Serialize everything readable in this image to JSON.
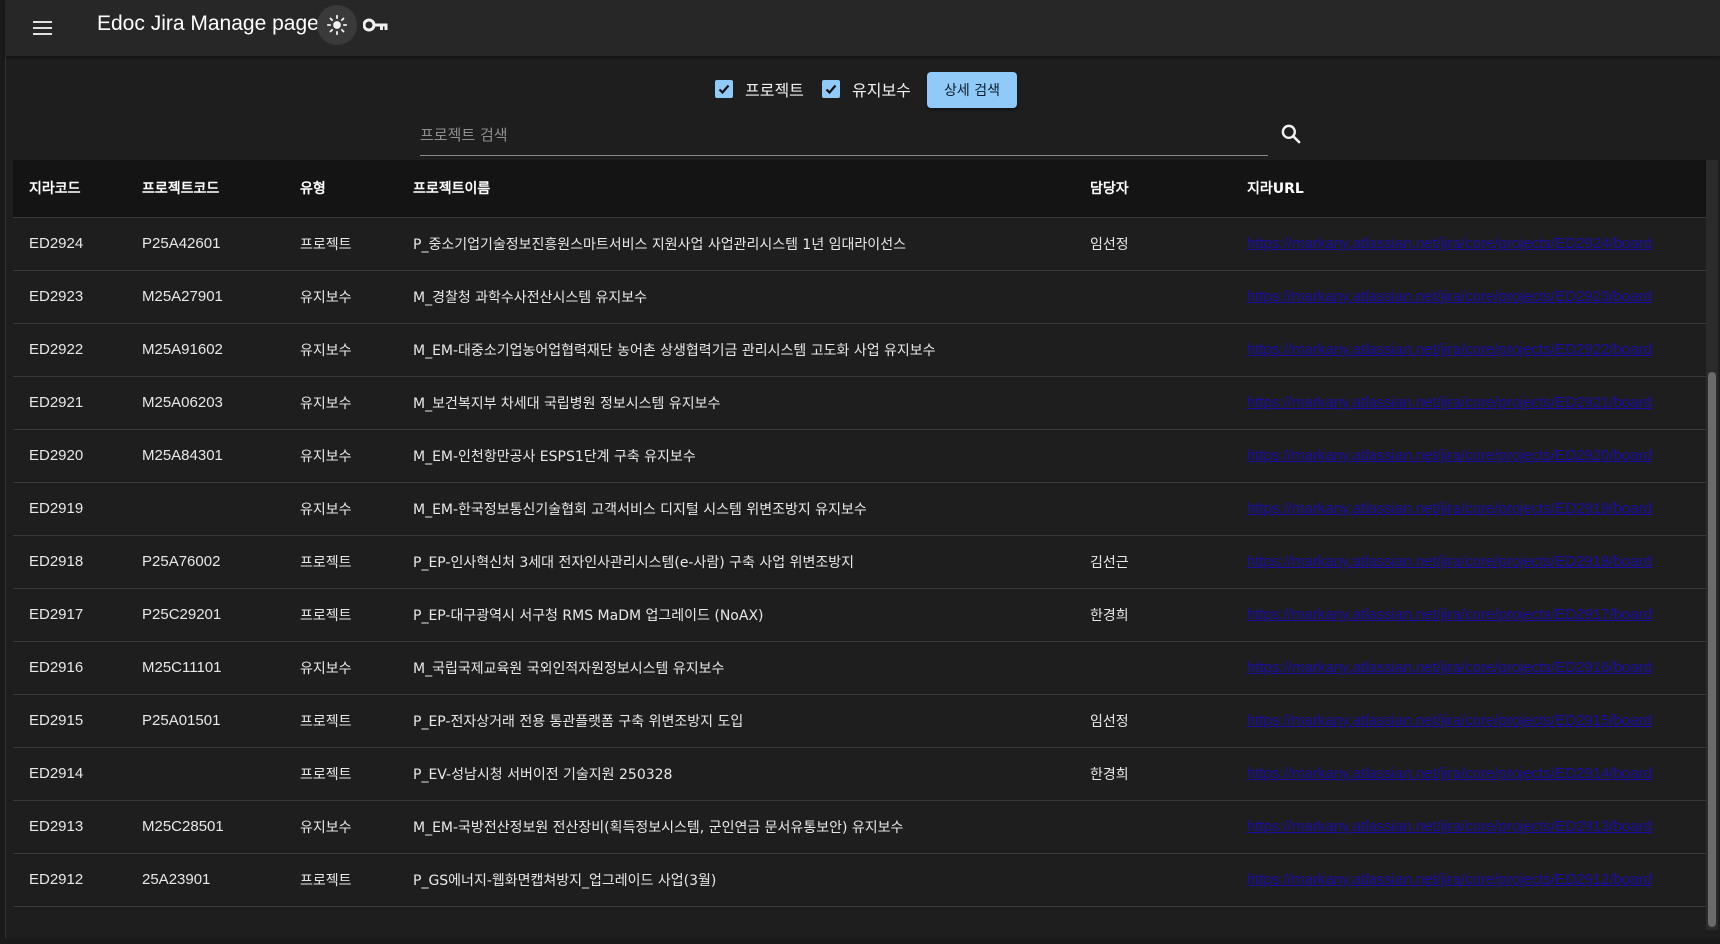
{
  "appbar": {
    "title": "Edoc Jira Manage page",
    "menu_icon": "menu-icon",
    "theme_icon": "sun-icon",
    "key_icon": "key-icon"
  },
  "filters": {
    "project_label": "프로젝트",
    "project_checked": true,
    "maintenance_label": "유지보수",
    "maintenance_checked": true,
    "detail_search_label": "상세 검색"
  },
  "search": {
    "placeholder": "프로젝트 검색",
    "value": ""
  },
  "table": {
    "headers": [
      "지라코드",
      "프로젝트코드",
      "유형",
      "프로젝트이름",
      "담당자",
      "지라URL"
    ],
    "rows": [
      {
        "jira": "ED2924",
        "code": "P25A42601",
        "type": "프로젝트",
        "name": "P_중소기업기술정보진흥원스마트서비스 지원사업 사업관리시스템 1년 임대라이선스",
        "owner": "임선정",
        "url": "https://markany.atlassian.net/jira/core/projects/ED2924/board"
      },
      {
        "jira": "ED2923",
        "code": "M25A27901",
        "type": "유지보수",
        "name": "M_경찰청 과학수사전산시스템 유지보수",
        "owner": "",
        "url": "https://markany.atlassian.net/jira/core/projects/ED2923/board"
      },
      {
        "jira": "ED2922",
        "code": "M25A91602",
        "type": "유지보수",
        "name": "M_EM-대중소기업농어업협력재단 농어촌 상생협력기금 관리시스템 고도화 사업 유지보수",
        "owner": "",
        "url": "https://markany.atlassian.net/jira/core/projects/ED2922/board"
      },
      {
        "jira": "ED2921",
        "code": "M25A06203",
        "type": "유지보수",
        "name": "M_보건복지부 차세대 국립병원 정보시스템 유지보수",
        "owner": "",
        "url": "https://markany.atlassian.net/jira/core/projects/ED2921/board"
      },
      {
        "jira": "ED2920",
        "code": "M25A84301",
        "type": "유지보수",
        "name": "M_EM-인천항만공사 ESPS1단계 구축 유지보수",
        "owner": "",
        "url": "https://markany.atlassian.net/jira/core/projects/ED2920/board"
      },
      {
        "jira": "ED2919",
        "code": "",
        "type": "유지보수",
        "name": "M_EM-한국정보통신기술협회 고객서비스 디지털 시스템 위변조방지 유지보수",
        "owner": "",
        "url": "https://markany.atlassian.net/jira/core/projects/ED2919/board"
      },
      {
        "jira": "ED2918",
        "code": "P25A76002",
        "type": "프로젝트",
        "name": "P_EP-인사혁신처 3세대 전자인사관리시스템(e-사람) 구축 사업 위변조방지",
        "owner": "김선근",
        "url": "https://markany.atlassian.net/jira/core/projects/ED2918/board"
      },
      {
        "jira": "ED2917",
        "code": "P25C29201",
        "type": "프로젝트",
        "name": "P_EP-대구광역시 서구청 RMS MaDM 업그레이드 (NoAX)",
        "owner": "한경희",
        "url": "https://markany.atlassian.net/jira/core/projects/ED2917/board"
      },
      {
        "jira": "ED2916",
        "code": "M25C11101",
        "type": "유지보수",
        "name": "M_국립국제교육원 국외인적자원정보시스템 유지보수",
        "owner": "",
        "url": "https://markany.atlassian.net/jira/core/projects/ED2916/board"
      },
      {
        "jira": "ED2915",
        "code": "P25A01501",
        "type": "프로젝트",
        "name": "P_EP-전자상거래 전용 통관플랫폼 구축 위변조방지 도입",
        "owner": "임선정",
        "url": "https://markany.atlassian.net/jira/core/projects/ED2915/board"
      },
      {
        "jira": "ED2914",
        "code": "",
        "type": "프로젝트",
        "name": "P_EV-성남시청 서버이전 기술지원 250328",
        "owner": "한경희",
        "url": "https://markany.atlassian.net/jira/core/projects/ED2914/board"
      },
      {
        "jira": "ED2913",
        "code": "M25C28501",
        "type": "유지보수",
        "name": "M_EM-국방전산정보원 전산장비(획득정보시스템, 군인연금 문서유통보안) 유지보수",
        "owner": "",
        "url": "https://markany.atlassian.net/jira/core/projects/ED2913/board"
      },
      {
        "jira": "ED2912",
        "code": "25A23901",
        "type": "프로젝트",
        "name": "P_GS에너지-웹화면캡쳐방지_업그레이드 사업(3월)",
        "owner": "",
        "url": "https://markany.atlassian.net/jira/core/projects/ED2912/board"
      }
    ]
  },
  "colors": {
    "accent": "#90caf9",
    "background": "#1e1e1e",
    "appbar": "#272727",
    "link": "#1a0dab"
  }
}
